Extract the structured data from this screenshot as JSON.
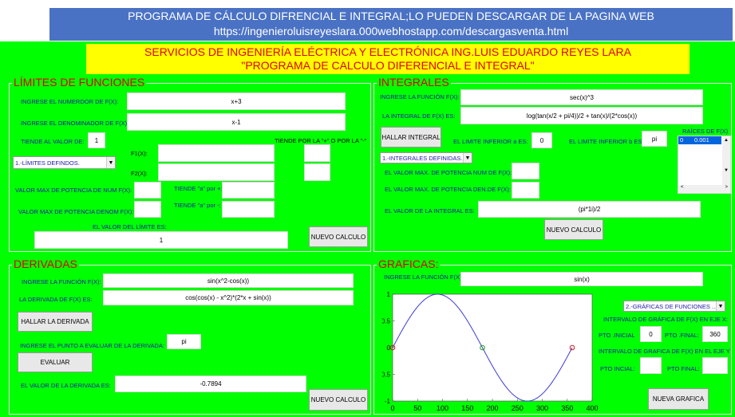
{
  "banner": {
    "line1": "PROGRAMA DE CÁLCULO DIFRENCIAL E INTEGRAL;LO PUEDEN DESCARGAR DE LA PAGINA WEB",
    "line2": "https://ingenieroluisreyeslara.000webhostapp.com/descargasventa.html"
  },
  "header": {
    "line1": "SERVICIOS DE INGENIERÍA ELÉCTRICA Y ELECTRÓNICA ING.LUIS EDUARDO REYES LARA",
    "line2": "\"PROGRAMA DE CALCULO DIFERENCIAL E INTEGRAL\""
  },
  "limits": {
    "title": "LÍMITES DE FUNCIONES",
    "numerator_label": "INGRESE EL NUMERDOR DE F(X):",
    "numerator_value": "x+3",
    "denominator_label": "INGRESE EL DENOMINADOR DE F(X):",
    "denominator_value": "x-1",
    "tends_label": "TIENDE AL VALOR DE:",
    "tends_value": "1",
    "side_label": "TIENDE POR LA \"+\" O POR LA \"-\"",
    "mode_select": "1.-LÍMITES DEFINDOS.",
    "f1_label": "F1(X):",
    "f2_label": "F2(X):",
    "max_num_label": "VALOR MAX DE POTENCIA DE NUM F(X):",
    "max_den_label": "VALOR MAX DE POTENCIA DENOM F(X):",
    "tends_plus_label": "TIENDE \"a\" por +:",
    "tends_minus_label": "TIENDE \"a\" por -:",
    "result_label": "EL VALOR DEL LÍMITE ES:",
    "result_value": "1",
    "new_button": "NUEVO CALCULO"
  },
  "integrals": {
    "title": "INTEGRALES",
    "function_label": "INGRESE LA FUNCIÓN F(X):",
    "function_value": "sec(x)^3",
    "integral_label": "LA INTEGRAL DE F(X) ES:",
    "integral_value": "log(tan(x/2 + pi/4))/2 + tan(x)/(2*cos(x))",
    "find_button": "HALLAR INTEGRAL",
    "lower_label": "EL LIMITE INFERIOR a ES:",
    "lower_value": "0",
    "upper_label": "EL LIMITE INFERIOR b ES:",
    "upper_value": "pi",
    "roots_label": "RAÍCES DE F(X)",
    "roots_rows": [
      {
        "idx": "0",
        "val": "0.001"
      }
    ],
    "mode_select": "1.-INTEGRALES DEFINIDAS.",
    "max_num_label": "EL VALOR MAX. DE POTENCIA NUM DE F(X):",
    "max_den_label": "EL VALOR MAX. DE POTENCIA DEN.DE F(X):",
    "result_label": "EL VALOR DE LA INTEGRAL ES:",
    "result_value": "(pi*1i)/2",
    "new_button": "NUEVO CALCULO"
  },
  "derivatives": {
    "title": "DERIVADAS",
    "function_label": "INGRESE LA FUNCIÓN F(X):",
    "function_value": "sin(x^2-cos(x))",
    "derivative_label": "LA DERIVADA DE F(X) ES:",
    "derivative_value": "cos(cos(x) - x^2)*(2*x + sin(x))",
    "find_button": "HALLAR LA DERIVADA",
    "point_label": "INGRESE EL PUNTO A EVALUAR DE LA DERIVADA:",
    "point_value": "pi",
    "eval_button": "EVALUAR",
    "result_label": "EL VALOR DE LA DERIVADA ES:",
    "result_value": "-0.7894",
    "new_button": "NUEVO CALCULO"
  },
  "graphs": {
    "title": "GRAFICAS:",
    "function_label": "INGRESE LA FUNCIÓN F(X):",
    "function_value": "sin(x)",
    "mode_select": "2.-GRÁFICAS DE FUNCIONES ...",
    "x_interval_label": "INTERVALO DE GRÁFICA DE F(X) EN EJE X:",
    "start_label": "PTO .INICIAL",
    "start_value": "0",
    "end_label": "PTO .FINAL:",
    "end_value": "360",
    "y_interval_label": "INTERVALO DE GRAFICA DE F(X) EN EL EJE Y",
    "y_start_label": "PTO INCIAL:",
    "y_end_label": "PTO FINAL:",
    "new_button": "NUEVA GRAFICA"
  },
  "chart_data": {
    "type": "line",
    "function": "sin(x)",
    "x_unit": "degrees",
    "xlim": [
      0,
      400
    ],
    "ylim": [
      -1,
      1
    ],
    "xticks": [
      "0",
      "50",
      "100",
      "150",
      "200",
      "250",
      "300",
      "350",
      "400"
    ],
    "yticks": [
      "1",
      "0.5",
      "0",
      "-0.5",
      "-1"
    ],
    "x_domain": [
      0,
      360
    ],
    "marked_points": [
      {
        "x": 0,
        "y": 0,
        "color": "#d02020"
      },
      {
        "x": 180,
        "y": 0,
        "color": "#20a020"
      },
      {
        "x": 360,
        "y": 0,
        "color": "#d02020"
      }
    ],
    "line_color": "#3a3ad8"
  }
}
